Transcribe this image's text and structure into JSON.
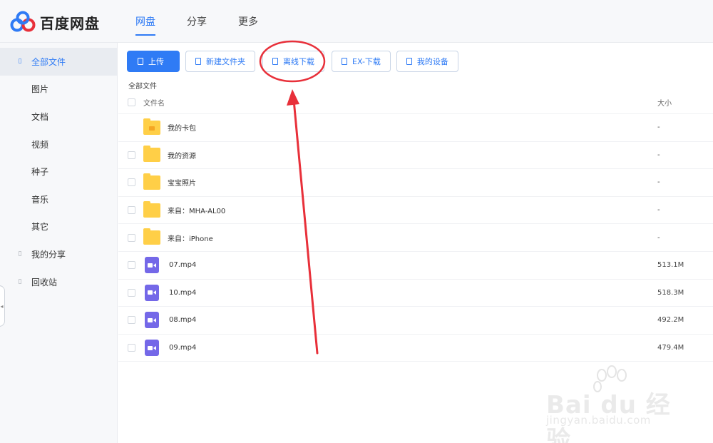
{
  "app": {
    "name": "百度网盘",
    "logo_icon": "baidu-netdisk-logo"
  },
  "nav": {
    "tabs": [
      {
        "label": "网盘",
        "active": true
      },
      {
        "label": "分享",
        "active": false
      },
      {
        "label": "更多",
        "active": false
      }
    ]
  },
  "sidebar": {
    "items": [
      {
        "label": "全部文件",
        "icon": "folder-icon",
        "active": true
      },
      {
        "label": "图片"
      },
      {
        "label": "文档"
      },
      {
        "label": "视频"
      },
      {
        "label": "种子"
      },
      {
        "label": "音乐"
      },
      {
        "label": "其它"
      },
      {
        "label": "我的分享",
        "icon": "share-icon"
      },
      {
        "label": "回收站",
        "icon": "trash-icon"
      }
    ]
  },
  "toolbar": {
    "upload": "上传",
    "new_folder": "新建文件夹",
    "offline_download": "离线下载",
    "ex_download": "EX-下载",
    "my_devices": "我的设备"
  },
  "breadcrumb": "全部文件",
  "list": {
    "columns": {
      "name": "文件名",
      "size": "大小"
    },
    "rows": [
      {
        "name": "我的卡包",
        "size": "-",
        "type": "folder-wallet"
      },
      {
        "name": "我的资源",
        "size": "-",
        "type": "folder"
      },
      {
        "name": "宝宝照片",
        "size": "-",
        "type": "folder"
      },
      {
        "name": "来自：MHA-AL00",
        "size": "-",
        "type": "folder"
      },
      {
        "name": "来自：iPhone",
        "size": "-",
        "type": "folder"
      },
      {
        "name": "07.mp4",
        "size": "513.1M",
        "type": "video"
      },
      {
        "name": "10.mp4",
        "size": "518.3M",
        "type": "video"
      },
      {
        "name": "08.mp4",
        "size": "492.2M",
        "type": "video"
      },
      {
        "name": "09.mp4",
        "size": "479.4M",
        "type": "video"
      }
    ]
  },
  "colors": {
    "accent": "#2f7bf5",
    "annotation": "#e8303a",
    "folder": "#ffcf47",
    "video": "#7468e8"
  },
  "watermark": {
    "brand": "Bai du 经验",
    "url": "jingyan.baidu.com"
  }
}
